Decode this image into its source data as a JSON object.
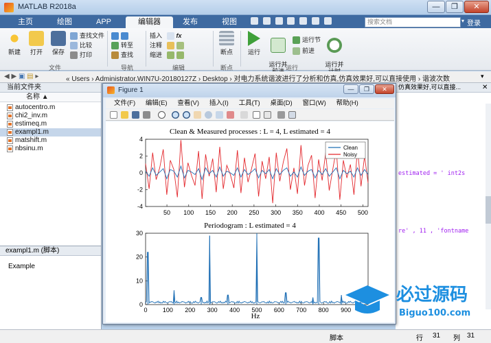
{
  "window": {
    "title": "MATLAB R2018a",
    "buttons": [
      "—",
      "❐",
      "✕"
    ]
  },
  "tabs": [
    "主页",
    "绘图",
    "APP",
    "编辑器",
    "发布",
    "视图"
  ],
  "active_tab": "编辑器",
  "search": {
    "placeholder": "搜索文档"
  },
  "login": "登录",
  "ribbon": {
    "file_group": {
      "label": "文件",
      "new": "新建",
      "open": "打开",
      "save": "保存",
      "find_files": "查找文件",
      "compare": "比较",
      "print": "打印"
    },
    "nav_group": {
      "label": "导航",
      "goto": "转至",
      "find": "查找"
    },
    "edit_group": {
      "label": "编辑",
      "insert": "插入",
      "comment": "注释",
      "indent": "缩进"
    },
    "breakpoints_group": {
      "label": "断点",
      "breakpoints": "断点"
    },
    "run_group": {
      "label": "运行",
      "run": "运行",
      "run_advance": "运行并\n前进",
      "run_section": "运行节",
      "advance": "前进",
      "run_time": "运行并\n计时"
    }
  },
  "address": {
    "path": "« Users › Administrator.WIN7U-20180127Z › Desktop › 对电力系统谐波进行了分析和仿真,仿真效果好,可以直接使用 › 谐波次数"
  },
  "current_folder": {
    "title": "当前文件夹",
    "column": "名称 ▲",
    "files": [
      "autocentro.m",
      "chi2_inv.m",
      "estimeq.m",
      "exampl1.m",
      "matshift.m",
      "nbsinu.m"
    ],
    "selected": "exampl1.m"
  },
  "details": {
    "title": "exampl1.m  (脚本)",
    "text": "Example"
  },
  "editor_snippets": {
    "tab_text": "仿真效果好,可以直接...",
    "line1": "estimated = '   int2s",
    "line2": "re' , 11 , 'fontname"
  },
  "status": {
    "script": "脚本",
    "row_label": "行",
    "row": "31",
    "col_label": "列",
    "col": "31"
  },
  "figure": {
    "title": "Figure 1",
    "menu": [
      "文件(F)",
      "编辑(E)",
      "查看(V)",
      "插入(I)",
      "工具(T)",
      "桌面(D)",
      "窗口(W)",
      "帮助(H)"
    ]
  },
  "colors": {
    "clean": "#1f6fb5",
    "noisy": "#e3262b",
    "periodogram": "#1f6fb5"
  },
  "chart_data": [
    {
      "type": "line",
      "title": "Clean & Measured processes : L = 4,  L estimated = 4",
      "xlabel": "",
      "ylabel": "",
      "xlim": [
        1,
        512
      ],
      "ylim": [
        -4,
        4
      ],
      "xticks": [
        50,
        100,
        150,
        200,
        250,
        300,
        350,
        400,
        450,
        500
      ],
      "yticks": [
        -4,
        -2,
        0,
        2,
        4
      ],
      "legend": {
        "position": "top-right",
        "entries": [
          "Clean",
          "Noisy"
        ]
      },
      "series": [
        {
          "name": "Clean",
          "values": [
            0.2,
            -0.4,
            0.6,
            -0.3,
            0.1,
            0.5,
            -0.7,
            0.4,
            0.2,
            -0.5,
            0.8,
            -0.6,
            0.3,
            0.1,
            -0.2,
            0.5,
            -0.8,
            0.6,
            -0.1,
            0.3,
            -0.5,
            0.7,
            -0.4,
            0.2,
            0.0,
            -0.3,
            0.6,
            -0.5,
            0.4,
            -0.2,
            0.1,
            0.5,
            -0.6,
            0.3,
            -0.1,
            0.4,
            -0.7,
            0.5,
            -0.2,
            0.3,
            0.6,
            -0.4,
            0.1,
            -0.5,
            0.7,
            -0.3,
            0.2,
            0.4,
            -0.6,
            0.3,
            -0.2,
            0.5,
            -0.4,
            0.1,
            0.6,
            -0.7,
            0.3,
            -0.1,
            0.2,
            -0.5,
            0.6,
            -0.3,
            0.4,
            -0.2
          ]
        },
        {
          "name": "Noisy",
          "values": [
            1.1,
            -1.9,
            2.4,
            -0.8,
            0.6,
            2.8,
            -2.6,
            1.5,
            0.4,
            -2.9,
            3.9,
            -1.7,
            1.2,
            -0.3,
            -1.5,
            2.6,
            -3.1,
            2.2,
            -0.4,
            1.7,
            -2.3,
            3.1,
            -1.9,
            0.9,
            -0.2,
            -1.8,
            2.7,
            -2.4,
            1.8,
            -1.1,
            0.5,
            2.3,
            -2.8,
            1.4,
            -0.7,
            1.9,
            -3.6,
            2.4,
            -1.0,
            1.3,
            2.9,
            -2.0,
            0.6,
            -2.5,
            3.3,
            -1.5,
            0.9,
            2.1,
            -3.0,
            1.6,
            -0.9,
            2.4,
            -2.1,
            0.4,
            2.8,
            -3.2,
            1.5,
            -0.6,
            1.0,
            -2.6,
            2.9,
            -1.6,
            2.0,
            -1.2
          ]
        }
      ]
    },
    {
      "type": "line",
      "title": "Periodogram :  L estimated = 4",
      "xlabel": "Hz",
      "ylabel": "",
      "xlim": [
        0,
        1000
      ],
      "ylim": [
        0,
        30
      ],
      "xticks": [
        0,
        100,
        200,
        300,
        400,
        500,
        600,
        700,
        800,
        900
      ],
      "yticks": [
        0,
        10,
        20,
        30
      ],
      "peaks": [
        {
          "x": 10,
          "y": 22
        },
        {
          "x": 128,
          "y": 6
        },
        {
          "x": 250,
          "y": 3
        },
        {
          "x": 288,
          "y": 29
        },
        {
          "x": 370,
          "y": 4
        },
        {
          "x": 500,
          "y": 30
        },
        {
          "x": 630,
          "y": 5
        },
        {
          "x": 752,
          "y": 3
        },
        {
          "x": 778,
          "y": 28
        },
        {
          "x": 880,
          "y": 4
        }
      ]
    }
  ],
  "watermark": {
    "text": "必过源码",
    "sub": "Biguo100.com"
  }
}
